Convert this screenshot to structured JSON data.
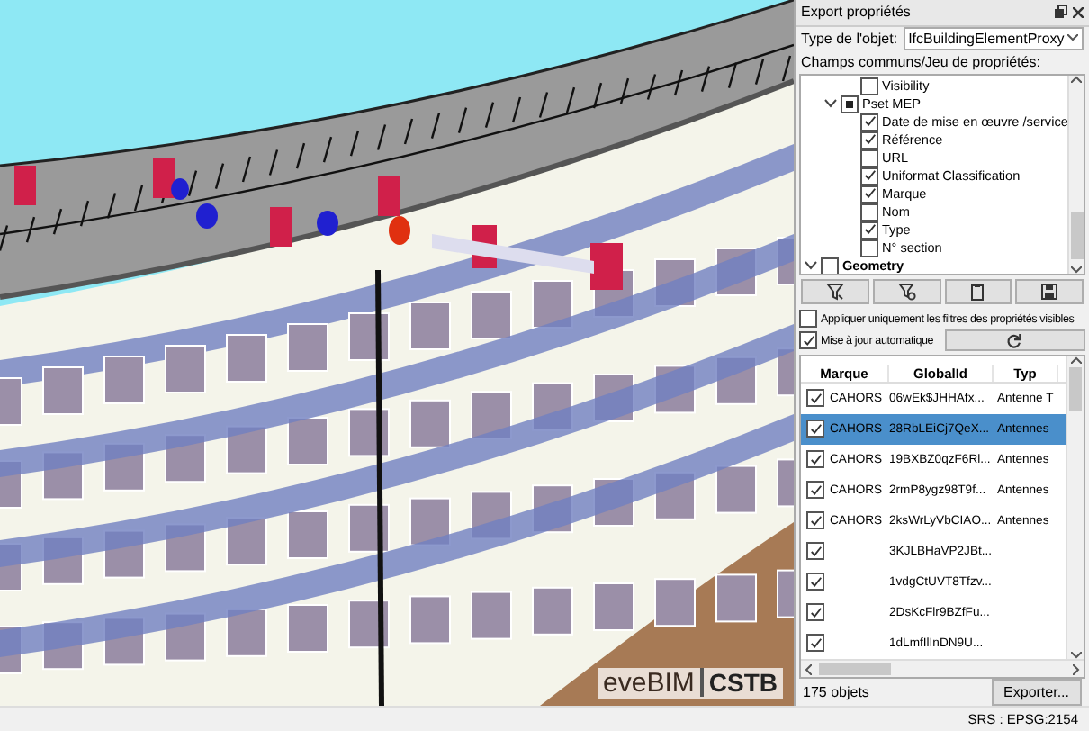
{
  "viewer": {
    "logo": {
      "name": "eveBIM",
      "org": "CSTB"
    }
  },
  "panel": {
    "title": "Export propriétés",
    "object_type": {
      "label": "Type de l'objet:",
      "value": "IfcBuildingElementProxy"
    },
    "fields_label": "Champs communs/Jeu de propriétés:",
    "tree": [
      {
        "children": [
          {
            "children": [
              {
                "label": "Visibility",
                "checked": false,
                "partial": false
              }
            ]
          },
          {
            "label": "Pset MEP",
            "checked": false,
            "partial": true,
            "expanded": true,
            "children": [
              {
                "label": "Date de mise en œuvre /service",
                "checked": true,
                "partial": false
              },
              {
                "label": "Référence",
                "checked": true,
                "partial": false
              },
              {
                "label": "URL",
                "checked": false,
                "partial": false
              },
              {
                "label": "Uniformat Classification",
                "checked": true,
                "partial": false
              },
              {
                "label": "Marque",
                "checked": true,
                "partial": false
              },
              {
                "label": "Nom",
                "checked": false,
                "partial": false
              },
              {
                "label": "Type",
                "checked": true,
                "partial": false
              },
              {
                "label": "N° section",
                "checked": false,
                "partial": false
              }
            ]
          }
        ]
      },
      {
        "label": "Geometry",
        "checked": false,
        "partial": false,
        "expanded": true
      }
    ],
    "filter_visible": {
      "label": "Appliquer uniquement les filtres des propriétés visibles",
      "checked": false
    },
    "auto_update": {
      "label": "Mise à jour automatique",
      "checked": true
    },
    "table": {
      "columns": [
        "Marque",
        "GlobalId",
        "Typ"
      ],
      "rows": [
        {
          "checked": true,
          "selected": false,
          "marque": "CAHORS",
          "globalid": "06wEk$JHHAfx...",
          "column_3": "Antenne T"
        },
        {
          "checked": true,
          "selected": true,
          "marque": "CAHORS",
          "globalid": "28RbLEiCj7QeX...",
          "column_3": "Antennes"
        },
        {
          "checked": true,
          "selected": false,
          "marque": "CAHORS",
          "globalid": "19BXBZ0qzF6Rl...",
          "column_3": "Antennes"
        },
        {
          "checked": true,
          "selected": false,
          "marque": "CAHORS",
          "globalid": "2rmP8ygz98T9f...",
          "column_3": "Antennes"
        },
        {
          "checked": true,
          "selected": false,
          "marque": "CAHORS",
          "globalid": "2ksWrLyVbCIAO...",
          "column_3": "Antennes"
        },
        {
          "checked": true,
          "selected": false,
          "globalid": "3KJLBHaVP2JBt..."
        },
        {
          "checked": true,
          "selected": false,
          "globalid": "1vdgCtUVT8Tfzv..."
        },
        {
          "checked": true,
          "selected": false,
          "globalid": "2DsKcFlr9BZfFu..."
        },
        {
          "checked": true,
          "selected": false,
          "globalid": "1dLmfIlInDN9U..."
        }
      ]
    },
    "count": "175 objets",
    "export_button": "Exporter..."
  },
  "status_bar": {
    "srs": "SRS : EPSG:2154"
  }
}
